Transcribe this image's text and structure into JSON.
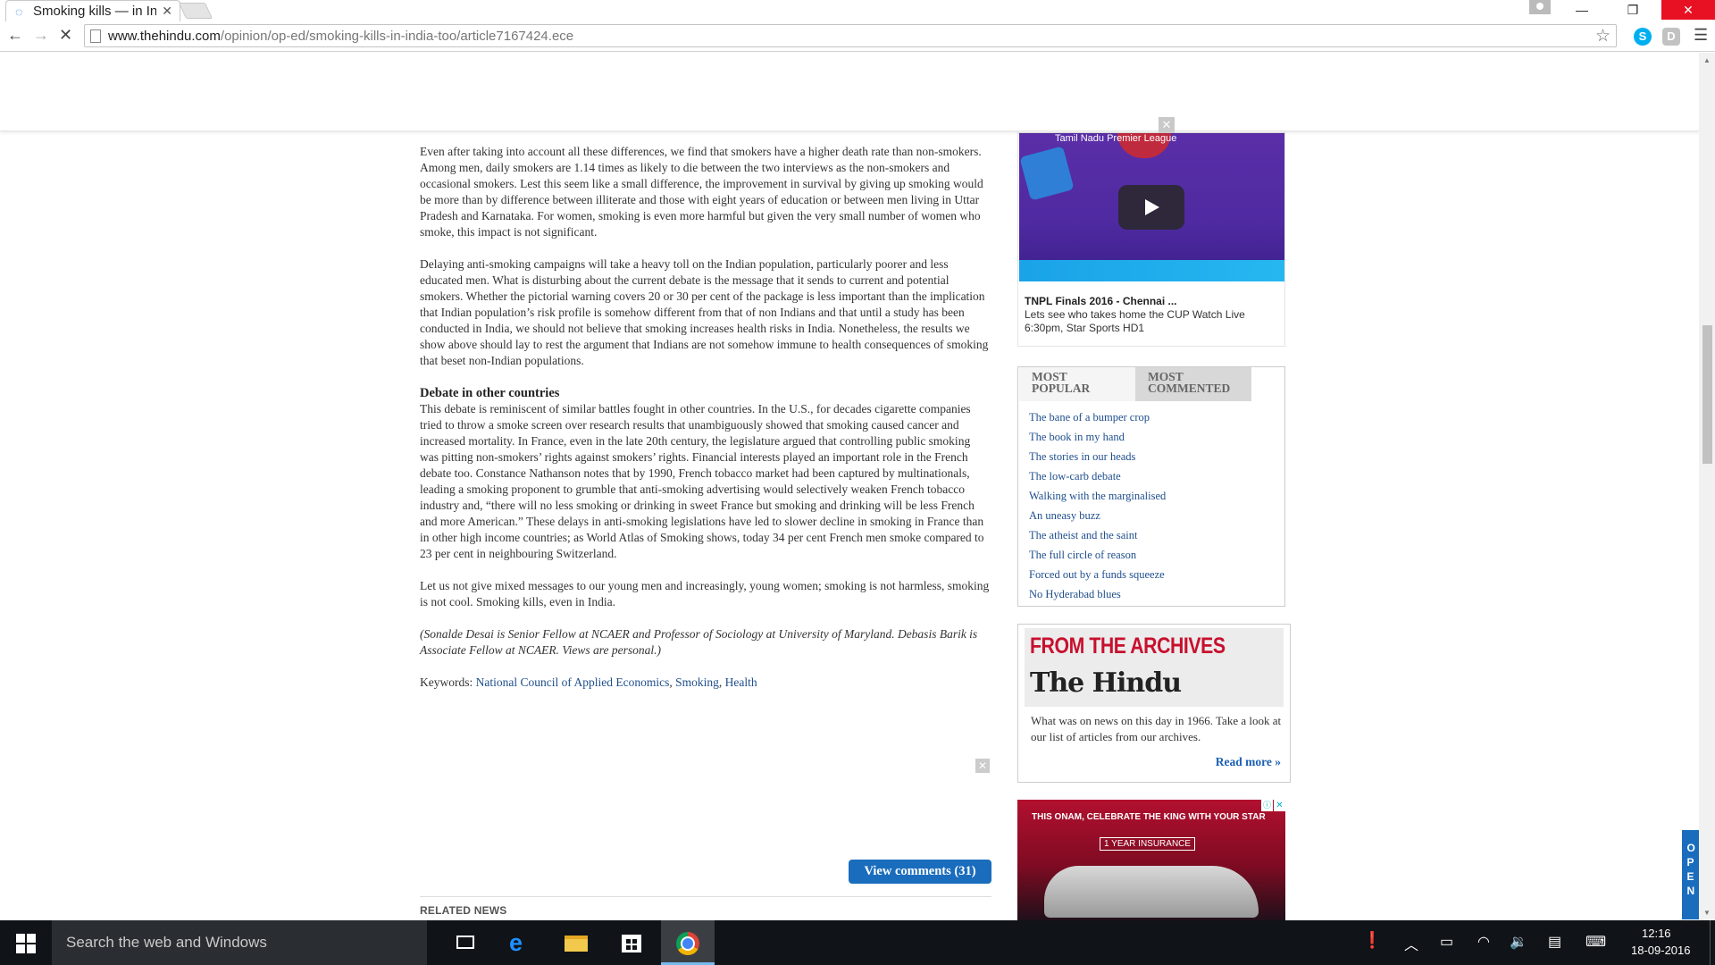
{
  "browser": {
    "tab_title": "Smoking kills — in India too",
    "url_domain": "www.thehindu.com",
    "url_path": "/opinion/op-ed/smoking-kills-in-india-too/article7167424.ece",
    "extension_skype": "S",
    "extension_d": "D"
  },
  "article": {
    "paragraphs": [
      "Even after taking into account all these differences, we find that smokers have a higher death rate than non-smokers. Among men, daily smokers are 1.14 times as likely to die between the two interviews as the non-smokers and occasional smokers. Lest this seem like a small difference, the improvement in survival by giving up smoking would be more than by difference between illiterate and those with eight years of education or between men living in Uttar Pradesh and Karnataka. For women, smoking is even more harmful but given the very small number of women who smoke, this impact is not significant.",
      "Delaying anti-smoking campaigns will take a heavy toll on the Indian population, particularly poorer and less educated men. What is disturbing about the current debate is the message that it sends to current and potential smokers. Whether the pictorial warning covers 20 or 30 per cent of the package is less important than the implication that Indian population’s risk profile is somehow different from that of non Indians and that until a study has been conducted in India, we should not believe that smoking increases health risks in India. Nonetheless, the results we show above should lay to rest the argument that Indians are not somehow immune to health consequences of smoking that beset non-Indian populations."
    ],
    "subheading": "Debate in other countries",
    "debate_paragraph": "This debate is reminiscent of similar battles fought in other countries. In the U.S., for decades cigarette companies tried to throw a smoke screen over research results that unambiguously showed that smoking caused cancer and increased mortality. In France, even in the late 20th century, the legislature argued that controlling public smoking was pitting non-smokers’ rights against smokers’ rights. Financial interests played an important role in the French debate too. Constance Nathanson notes that by 1990, French tobacco market had been captured by multinationals, leading a smoking proponent to grumble that anti-smoking advertising would selectively weaken French tobacco industry and, “there will no less smoking or drinking in sweet France but smoking and drinking will be less French and more American.” These delays in anti-smoking legislations have led to slower decline in smoking in France than in other high income countries; as World Atlas of Smoking shows, today 34 per cent French men smoke compared to 23 per cent in neighbouring Switzerland.",
    "closing_paragraph": "Let us not give mixed messages to our young men and increasingly, young women; smoking is not harmless, smoking is not cool. Smoking kills, even in India.",
    "byline": "(Sonalde Desai is Senior Fellow at NCAER and Professor of Sociology at University of Maryland. Debasis Barik is Associate Fellow at NCAER. Views are personal.)",
    "keywords_label": "Keywords:",
    "keyword_links": [
      "National Council of Applied Economics",
      "Smoking",
      "Health"
    ],
    "view_comments": "View comments (31)",
    "related_news": "RELATED NEWS"
  },
  "video": {
    "channel": "Tamil Nadu Premier League",
    "title": "TNPL Finals 2016 - Chennai ...",
    "description": "Lets see who takes home the CUP Watch Live 6:30pm, Star Sports HD1"
  },
  "popular": {
    "tab_most_popular": "MOST POPULAR",
    "tab_most_commented": "MOST COMMENTED",
    "items": [
      "The bane of a bumper crop",
      "The book in my hand",
      "The stories in our heads",
      "The low-carb debate",
      "Walking with the marginalised",
      "An uneasy buzz",
      "The atheist and the saint",
      "The full circle of reason",
      "Forced out by a funds squeeze",
      "No Hyderabad blues"
    ]
  },
  "archives": {
    "heading": "FROM THE ARCHIVES",
    "masthead": "The Hindu",
    "text": "What was on news on this day in 1966. Take a look at our list of articles from our archives.",
    "read_more": "Read more »"
  },
  "ad": {
    "line1": "THIS ONAM, CELEBRATE THE KING WITH YOUR STAR",
    "line2": "1 YEAR INSURANCE"
  },
  "open_tab": "OPEN",
  "taskbar": {
    "search_placeholder": "Search the web and Windows",
    "time": "12:16",
    "date": "18-09-2016"
  },
  "colors": {
    "link": "#1e4e8c",
    "button_blue": "#1a6dbd",
    "archives_red": "#c8102e",
    "close_red": "#e81123"
  }
}
